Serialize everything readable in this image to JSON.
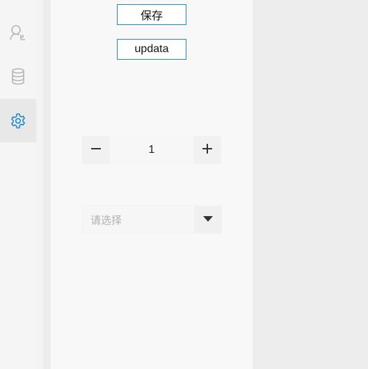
{
  "colors": {
    "accent": "#1e8bc3",
    "icon_inactive": "#b5b5b5"
  },
  "sidebar": {
    "items": [
      {
        "icon": "user-settings-icon",
        "active": false
      },
      {
        "icon": "database-icon",
        "active": false
      },
      {
        "icon": "gear-icon",
        "active": true
      }
    ]
  },
  "buttons": {
    "save_label": "保存",
    "update_label": "updata"
  },
  "stepper": {
    "value": "1",
    "decrement_icon": "minus-icon",
    "increment_icon": "plus-icon"
  },
  "select": {
    "placeholder": "请选择",
    "arrow_icon": "caret-down-icon"
  }
}
